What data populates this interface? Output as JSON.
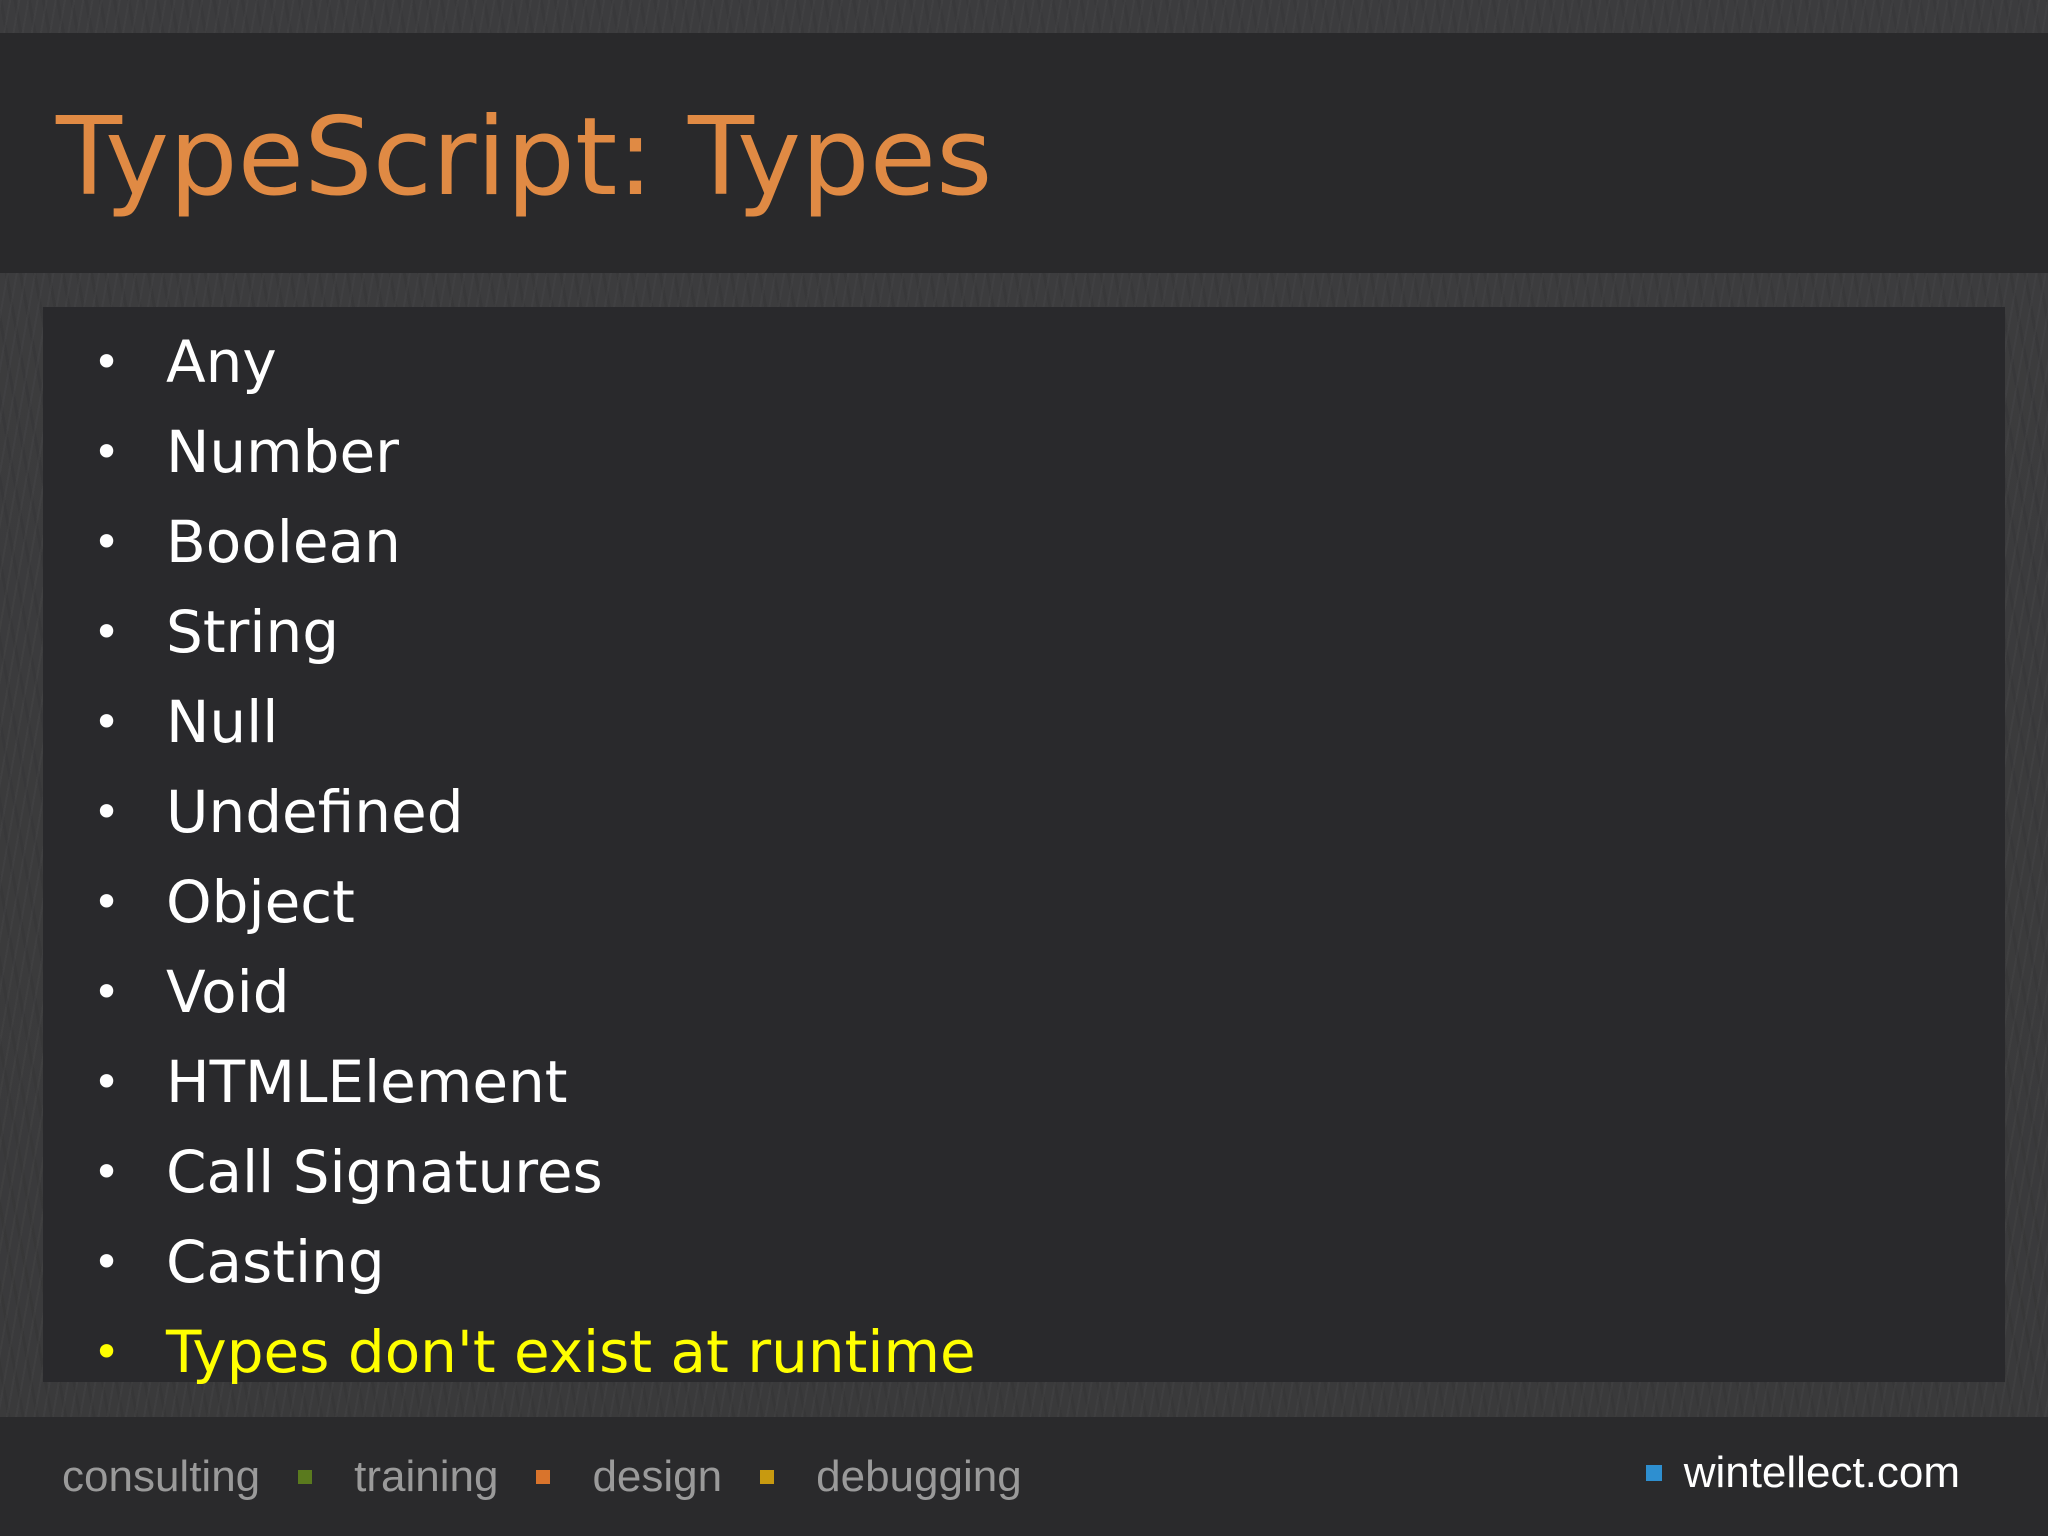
{
  "slide": {
    "title": "TypeScript: Types",
    "bullets": [
      {
        "text": "Any",
        "highlight": false
      },
      {
        "text": "Number",
        "highlight": false
      },
      {
        "text": "Boolean",
        "highlight": false
      },
      {
        "text": "String",
        "highlight": false
      },
      {
        "text": "Null",
        "highlight": false
      },
      {
        "text": "Undefined",
        "highlight": false
      },
      {
        "text": "Object",
        "highlight": false
      },
      {
        "text": "Void",
        "highlight": false
      },
      {
        "text": "HTMLElement",
        "highlight": false
      },
      {
        "text": "Call Signatures",
        "highlight": false
      },
      {
        "text": "Casting",
        "highlight": false
      },
      {
        "text": "Types don't exist at runtime",
        "highlight": true
      }
    ],
    "bullet_glyph": "•"
  },
  "footer": {
    "items": [
      "consulting",
      "training",
      "design",
      "debugging"
    ],
    "separator_colors": [
      "#5a7a1e",
      "#d9742c",
      "#c89a10"
    ],
    "site": "wintellect.com",
    "site_square_color": "#2e8fd0"
  },
  "colors": {
    "title": "#e08a44",
    "bullet_text": "#ffffff",
    "highlight_text": "#ffff00",
    "footer_text": "#9a9a9a"
  }
}
